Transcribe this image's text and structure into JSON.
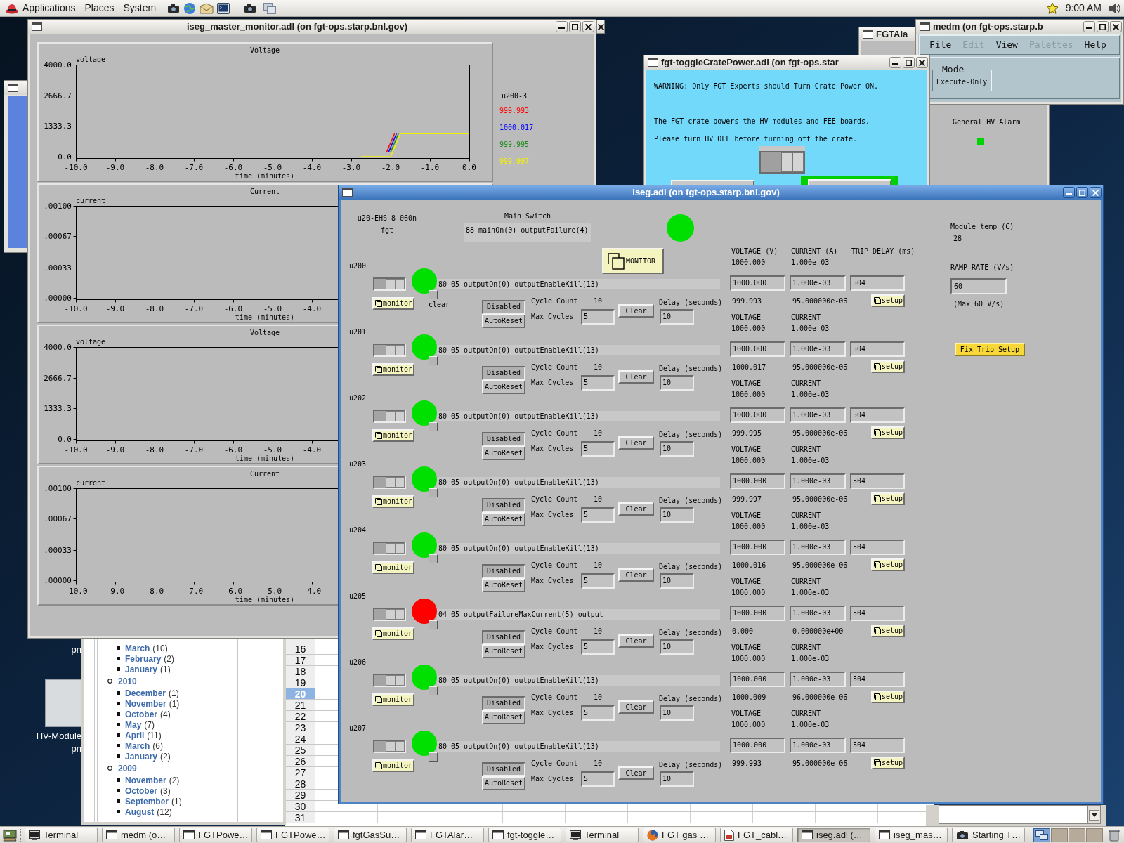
{
  "top_panel": {
    "menus": [
      "Applications",
      "Places",
      "System"
    ],
    "clock": "9:00 AM"
  },
  "background_windows": [
    {
      "active": false
    },
    {
      "active": false
    }
  ],
  "desktop_icons": [
    {
      "label_lines": [
        "pn"
      ],
      "thumbnail": false
    },
    {
      "label_lines": [
        "HV-Module",
        "pn"
      ],
      "thumbnail": true
    }
  ],
  "blog_archive": {
    "months": [
      {
        "month": "March",
        "count": "(10)"
      },
      {
        "month": "February",
        "count": "(2)"
      },
      {
        "month": "January",
        "count": "(1)"
      }
    ],
    "years": [
      {
        "year": "2010",
        "months": [
          {
            "month": "December",
            "count": "(1)"
          },
          {
            "month": "November",
            "count": "(1)"
          },
          {
            "month": "October",
            "count": "(4)"
          },
          {
            "month": "May",
            "count": "(7)"
          },
          {
            "month": "April",
            "count": "(11)"
          },
          {
            "month": "March",
            "count": "(6)"
          },
          {
            "month": "January",
            "count": "(2)"
          }
        ]
      },
      {
        "year": "2009",
        "months": [
          {
            "month": "November",
            "count": "(2)"
          },
          {
            "month": "October",
            "count": "(3)"
          },
          {
            "month": "September",
            "count": "(1)"
          },
          {
            "month": "August",
            "count": "(12)"
          }
        ]
      }
    ]
  },
  "spreadsheet": {
    "rows": [
      {
        "label": "16",
        "selected": false
      },
      {
        "label": "17",
        "selected": false
      },
      {
        "label": "18",
        "selected": false
      },
      {
        "label": "19",
        "selected": false
      },
      {
        "label": "20",
        "selected": true
      },
      {
        "label": "21",
        "selected": false
      },
      {
        "label": "22",
        "selected": false
      },
      {
        "label": "23",
        "selected": false
      },
      {
        "label": "24",
        "selected": false
      },
      {
        "label": "25",
        "selected": false
      },
      {
        "label": "26",
        "selected": false
      },
      {
        "label": "27",
        "selected": false
      },
      {
        "label": "28",
        "selected": false
      },
      {
        "label": "29",
        "selected": false
      },
      {
        "label": "30",
        "selected": false
      },
      {
        "label": "31",
        "selected": false
      }
    ]
  },
  "alarm_window": {
    "title": "FGTAla",
    "active": false,
    "label": "General HV Alarm",
    "color": "#00d400"
  },
  "medm_window": {
    "title": "medm (on fgt-ops.starp.b",
    "active": false,
    "menu": [
      {
        "label": "File",
        "disabled": false
      },
      {
        "label": "Edit",
        "disabled": true
      },
      {
        "label": "View",
        "disabled": false
      },
      {
        "label": "Palettes",
        "disabled": true
      },
      {
        "label": "Help",
        "disabled": false
      }
    ],
    "mode_legend": "Mode",
    "mode": "Execute-Only"
  },
  "toggle_window": {
    "title": "fgt-toggleCratePower.adl (on fgt-ops.star",
    "active": false,
    "lines": [
      "WARNING: Only FGT Experts should Turn Crate Power ON.",
      "The FGT crate powers the HV modules and FEE boards.",
      "Please turn HV OFF before turning off the crate."
    ],
    "switch_on": true
  },
  "master_monitor": {
    "title": "iseg_master_monitor.adl (on fgt-ops.starp.bnl.gov)",
    "active": false,
    "charts": [
      {
        "legend_title": "u200-3",
        "chart_data": {
          "type": "line",
          "title": "Voltage",
          "ylabel": "voltage",
          "xlabel": "time (minutes)",
          "x": [
            -2.75,
            -2.15,
            -2.1,
            -2.05,
            -2.0,
            -1.95,
            -1.9,
            -1.85,
            -1.8,
            -1.75,
            0
          ],
          "series": [
            {
              "name": "999.993",
              "color": "#ff0000",
              "values": [
                null,
                null,
                200,
                400,
                600,
                800,
                1000,
                null,
                null,
                null,
                null
              ]
            },
            {
              "name": "1000.017",
              "color": "#0000ff",
              "values": [
                null,
                null,
                null,
                200,
                400,
                600,
                800,
                1000,
                null,
                null,
                null
              ]
            },
            {
              "name": "999.995",
              "color": "#1f8a1f",
              "values": [
                null,
                null,
                null,
                null,
                200,
                400,
                600,
                800,
                1000,
                null,
                null
              ]
            },
            {
              "name": "999.997",
              "color": "#f2f200",
              "values": [
                0,
                0,
                0,
                0,
                0,
                200,
                400,
                600,
                800,
                1000,
                1000
              ]
            }
          ],
          "xlim": [
            -10,
            0
          ],
          "ylim": [
            0,
            4000
          ],
          "xticks": [
            {
              "value": -10,
              "label": "-10.0"
            },
            {
              "value": -9,
              "label": "-9.0"
            },
            {
              "value": -8,
              "label": "-8.0"
            },
            {
              "value": -7,
              "label": "-7.0"
            },
            {
              "value": -6,
              "label": "-6.0"
            },
            {
              "value": -5,
              "label": "-5.0"
            },
            {
              "value": -4,
              "label": "-4.0"
            },
            {
              "value": -3,
              "label": "-3.0"
            },
            {
              "value": -2,
              "label": "-2.0"
            },
            {
              "value": -1,
              "label": "-1.0"
            },
            {
              "value": 0,
              "label": "0.0"
            }
          ],
          "yticks": [
            {
              "value": 0,
              "label": "0.0"
            },
            {
              "value": 1333.3,
              "label": "1333.3"
            },
            {
              "value": 2666.7,
              "label": "2666.7"
            },
            {
              "value": 4000,
              "label": "4000.0"
            }
          ]
        }
      },
      {
        "chart_data": {
          "type": "line",
          "title": "Current",
          "ylabel": "current",
          "xlabel": "time (minutes)",
          "xlim": [
            -10,
            0
          ],
          "ylim": [
            0,
            0.001
          ],
          "xticks": [
            {
              "value": -10,
              "label": "-10.0"
            },
            {
              "value": -9,
              "label": "-9.0"
            },
            {
              "value": -8,
              "label": "-8.0"
            },
            {
              "value": -7,
              "label": "-7.0"
            },
            {
              "value": -6,
              "label": "-6.0"
            },
            {
              "value": -5,
              "label": "-5.0"
            },
            {
              "value": -4,
              "label": "-4.0"
            }
          ],
          "yticks": [
            {
              "value": 0,
              "label": ".00000"
            },
            {
              "value": 0.00033,
              "label": ".00033"
            },
            {
              "value": 0.00067,
              "label": ".00067"
            },
            {
              "value": 0.001,
              "label": ".00100"
            }
          ]
        }
      },
      {
        "chart_data": {
          "type": "line",
          "title": "Voltage",
          "ylabel": "voltage",
          "xlabel": "time (minutes)",
          "xlim": [
            -10,
            0
          ],
          "ylim": [
            0,
            4000
          ],
          "xticks": [
            {
              "value": -10,
              "label": "-10.0"
            },
            {
              "value": -9,
              "label": "-9.0"
            },
            {
              "value": -8,
              "label": "-8.0"
            },
            {
              "value": -7,
              "label": "-7.0"
            },
            {
              "value": -6,
              "label": "-6.0"
            },
            {
              "value": -5,
              "label": "-5.0"
            },
            {
              "value": -4,
              "label": "-4.0"
            }
          ],
          "yticks": [
            {
              "value": 0,
              "label": "0.0"
            },
            {
              "value": 1333.3,
              "label": "1333.3"
            },
            {
              "value": 2666.7,
              "label": "2666.7"
            },
            {
              "value": 4000,
              "label": "4000.0"
            }
          ]
        }
      },
      {
        "chart_data": {
          "type": "line",
          "title": "Current",
          "ylabel": "current",
          "xlabel": "time (minutes)",
          "xlim": [
            -10,
            0
          ],
          "ylim": [
            0,
            0.001
          ],
          "xticks": [
            {
              "value": -10,
              "label": "-10.0"
            },
            {
              "value": -9,
              "label": "-9.0"
            },
            {
              "value": -8,
              "label": "-8.0"
            },
            {
              "value": -7,
              "label": "-7.0"
            },
            {
              "value": -6,
              "label": "-6.0"
            },
            {
              "value": -5,
              "label": "-5.0"
            },
            {
              "value": -4,
              "label": "-4.0"
            }
          ],
          "yticks": [
            {
              "value": 0,
              "label": ".00000"
            },
            {
              "value": 0.00033,
              "label": ".00033"
            },
            {
              "value": 0.00067,
              "label": ".00067"
            },
            {
              "value": 0.001,
              "label": ".00100"
            }
          ]
        }
      }
    ]
  },
  "iseg_window": {
    "title": "iseg.adl (on fgt-ops.starp.bnl.gov)",
    "active": true,
    "module_name": "u20-EHS 8 060n",
    "module_group": "fgt",
    "main_switch": {
      "label": "Main Switch",
      "status": "88 mainOn(0) outputFailure(4)",
      "color": "#00e000"
    },
    "monitor_button": "MONITOR",
    "module_temp_label": "Module temp (C)",
    "module_temp": "28",
    "ramp_rate_label": "RAMP RATE (V/s)",
    "ramp_rate": "60",
    "ramp_rate_note": "(Max 60 V/s)",
    "fix_button": "Fix Trip Setup",
    "channels": [
      {
        "name": "u200",
        "on": true,
        "color": "#00e000",
        "status": "80 05 outputOn(0) outputEnableKill(13)",
        "clear_label": "clear",
        "monitor": "monitor",
        "headers": [
          "VOLTAGE (V)",
          "CURRENT (A)",
          "TRIP DELAY (ms)"
        ],
        "set_voltage": "1000.000",
        "set_current": "1.000e-03",
        "voltage_input": "1000.000",
        "current_input": "1.000e-03",
        "trip_delay_input": "504",
        "voltage": "999.993",
        "current": "95.000000e-06",
        "setup": "setup",
        "modes": [
          {
            "label": "Disabled",
            "selected": true
          },
          {
            "label": "AutoReset",
            "selected": false
          }
        ],
        "cycle_count_label": "Cycle Count",
        "cycle_count": "10",
        "max_cycles_label": "Max Cycles",
        "max_cycles": "5",
        "clear_button": "Clear",
        "delay_label": "Delay (seconds)",
        "delay": "10"
      },
      {
        "name": "u201",
        "on": true,
        "color": "#00e000",
        "status": "80 05 outputOn(0) outputEnableKill(13)",
        "monitor": "monitor",
        "headers": [
          "VOLTAGE",
          "CURRENT"
        ],
        "set_voltage": "1000.000",
        "set_current": "1.000e-03",
        "voltage_input": "1000.000",
        "current_input": "1.000e-03",
        "trip_delay_input": "504",
        "voltage": "1000.017",
        "current": "95.000000e-06",
        "setup": "setup",
        "modes": [
          {
            "label": "Disabled",
            "selected": true
          },
          {
            "label": "AutoReset",
            "selected": false
          }
        ],
        "cycle_count_label": "Cycle Count",
        "cycle_count": "10",
        "max_cycles_label": "Max Cycles",
        "max_cycles": "5",
        "clear_button": "Clear",
        "delay_label": "Delay (seconds)",
        "delay": "10"
      },
      {
        "name": "u202",
        "on": true,
        "color": "#00e000",
        "status": "80 05 outputOn(0) outputEnableKill(13)",
        "monitor": "monitor",
        "headers": [
          "VOLTAGE",
          "CURRENT"
        ],
        "set_voltage": "1000.000",
        "set_current": "1.000e-03",
        "voltage_input": "1000.000",
        "current_input": "1.000e-03",
        "trip_delay_input": "504",
        "voltage": "999.995",
        "current": "95.000000e-06",
        "setup": "setup",
        "modes": [
          {
            "label": "Disabled",
            "selected": true
          },
          {
            "label": "AutoReset",
            "selected": false
          }
        ],
        "cycle_count_label": "Cycle Count",
        "cycle_count": "10",
        "max_cycles_label": "Max Cycles",
        "max_cycles": "5",
        "clear_button": "Clear",
        "delay_label": "Delay (seconds)",
        "delay": "10"
      },
      {
        "name": "u203",
        "on": true,
        "color": "#00e000",
        "status": "80 05 outputOn(0) outputEnableKill(13)",
        "monitor": "monitor",
        "headers": [
          "VOLTAGE",
          "CURRENT"
        ],
        "set_voltage": "1000.000",
        "set_current": "1.000e-03",
        "voltage_input": "1000.000",
        "current_input": "1.000e-03",
        "trip_delay_input": "504",
        "voltage": "999.997",
        "current": "95.000000e-06",
        "setup": "setup",
        "modes": [
          {
            "label": "Disabled",
            "selected": true
          },
          {
            "label": "AutoReset",
            "selected": false
          }
        ],
        "cycle_count_label": "Cycle Count",
        "cycle_count": "10",
        "max_cycles_label": "Max Cycles",
        "max_cycles": "5",
        "clear_button": "Clear",
        "delay_label": "Delay (seconds)",
        "delay": "10"
      },
      {
        "name": "u204",
        "on": true,
        "color": "#00e000",
        "status": "80 05 outputOn(0) outputEnableKill(13)",
        "monitor": "monitor",
        "headers": [
          "VOLTAGE",
          "CURRENT"
        ],
        "set_voltage": "1000.000",
        "set_current": "1.000e-03",
        "voltage_input": "1000.000",
        "current_input": "1.000e-03",
        "trip_delay_input": "504",
        "voltage": "1000.016",
        "current": "95.000000e-06",
        "setup": "setup",
        "modes": [
          {
            "label": "Disabled",
            "selected": true
          },
          {
            "label": "AutoReset",
            "selected": false
          }
        ],
        "cycle_count_label": "Cycle Count",
        "cycle_count": "10",
        "max_cycles_label": "Max Cycles",
        "max_cycles": "5",
        "clear_button": "Clear",
        "delay_label": "Delay (seconds)",
        "delay": "10"
      },
      {
        "name": "u205",
        "on": true,
        "color": "#ff0000",
        "status": "04 05 outputFailureMaxCurrent(5) output",
        "monitor": "monitor",
        "headers": [
          "VOLTAGE",
          "CURRENT"
        ],
        "set_voltage": "1000.000",
        "set_current": "1.000e-03",
        "voltage_input": "1000.000",
        "current_input": "1.000e-03",
        "trip_delay_input": "504",
        "voltage": "0.000",
        "current": "0.000000e+00",
        "setup": "setup",
        "modes": [
          {
            "label": "Disabled",
            "selected": true
          },
          {
            "label": "AutoReset",
            "selected": false
          }
        ],
        "cycle_count_label": "Cycle Count",
        "cycle_count": "10",
        "max_cycles_label": "Max Cycles",
        "max_cycles": "5",
        "clear_button": "Clear",
        "delay_label": "Delay (seconds)",
        "delay": "10"
      },
      {
        "name": "u206",
        "on": true,
        "color": "#00e000",
        "status": "80 05 outputOn(0) outputEnableKill(13)",
        "monitor": "monitor",
        "headers": [
          "VOLTAGE",
          "CURRENT"
        ],
        "set_voltage": "1000.000",
        "set_current": "1.000e-03",
        "voltage_input": "1000.000",
        "current_input": "1.000e-03",
        "trip_delay_input": "504",
        "voltage": "1000.009",
        "current": "96.000000e-06",
        "setup": "setup",
        "modes": [
          {
            "label": "Disabled",
            "selected": true
          },
          {
            "label": "AutoReset",
            "selected": false
          }
        ],
        "cycle_count_label": "Cycle Count",
        "cycle_count": "10",
        "max_cycles_label": "Max Cycles",
        "max_cycles": "5",
        "clear_button": "Clear",
        "delay_label": "Delay (seconds)",
        "delay": "10"
      },
      {
        "name": "u207",
        "on": true,
        "color": "#00e000",
        "status": "80 05 outputOn(0) outputEnableKill(13)",
        "monitor": "monitor",
        "headers": [
          "VOLTAGE",
          "CURRENT"
        ],
        "set_voltage": "1000.000",
        "set_current": "1.000e-03",
        "voltage_input": "1000.000",
        "current_input": "1.000e-03",
        "trip_delay_input": "504",
        "voltage": "999.993",
        "current": "95.000000e-06",
        "setup": "setup",
        "modes": [
          {
            "label": "Disabled",
            "selected": true
          },
          {
            "label": "AutoReset",
            "selected": false
          }
        ],
        "cycle_count_label": "Cycle Count",
        "cycle_count": "10",
        "max_cycles_label": "Max Cycles",
        "max_cycles": "5",
        "clear_button": "Clear",
        "delay_label": "Delay (seconds)",
        "delay": "10"
      }
    ]
  },
  "taskbar": {
    "items": [
      {
        "label": "Terminal",
        "kind": "terminal",
        "selected": false
      },
      {
        "label": "medm (o…",
        "kind": "window",
        "selected": false
      },
      {
        "label": "FGTPowe…",
        "kind": "window",
        "selected": false
      },
      {
        "label": "FGTPowe…",
        "kind": "window",
        "selected": false
      },
      {
        "label": "fgtGasSu…",
        "kind": "window",
        "selected": false
      },
      {
        "label": "FGTAlar…",
        "kind": "window",
        "selected": false
      },
      {
        "label": "fgt-toggle…",
        "kind": "window",
        "selected": false
      },
      {
        "label": "Terminal",
        "kind": "terminal",
        "selected": false
      },
      {
        "label": "FGT gas …",
        "kind": "browser",
        "selected": false
      },
      {
        "label": "FGT_cabl…",
        "kind": "document",
        "selected": false
      },
      {
        "label": "iseg.adl (…",
        "kind": "window",
        "selected": true
      },
      {
        "label": "iseg_mas…",
        "kind": "window",
        "selected": false
      },
      {
        "label": "Starting T…",
        "kind": "camera",
        "selected": false
      }
    ],
    "workspaces": [
      {
        "selected": true
      },
      {
        "selected": false
      },
      {
        "selected": false
      },
      {
        "selected": false
      }
    ]
  }
}
